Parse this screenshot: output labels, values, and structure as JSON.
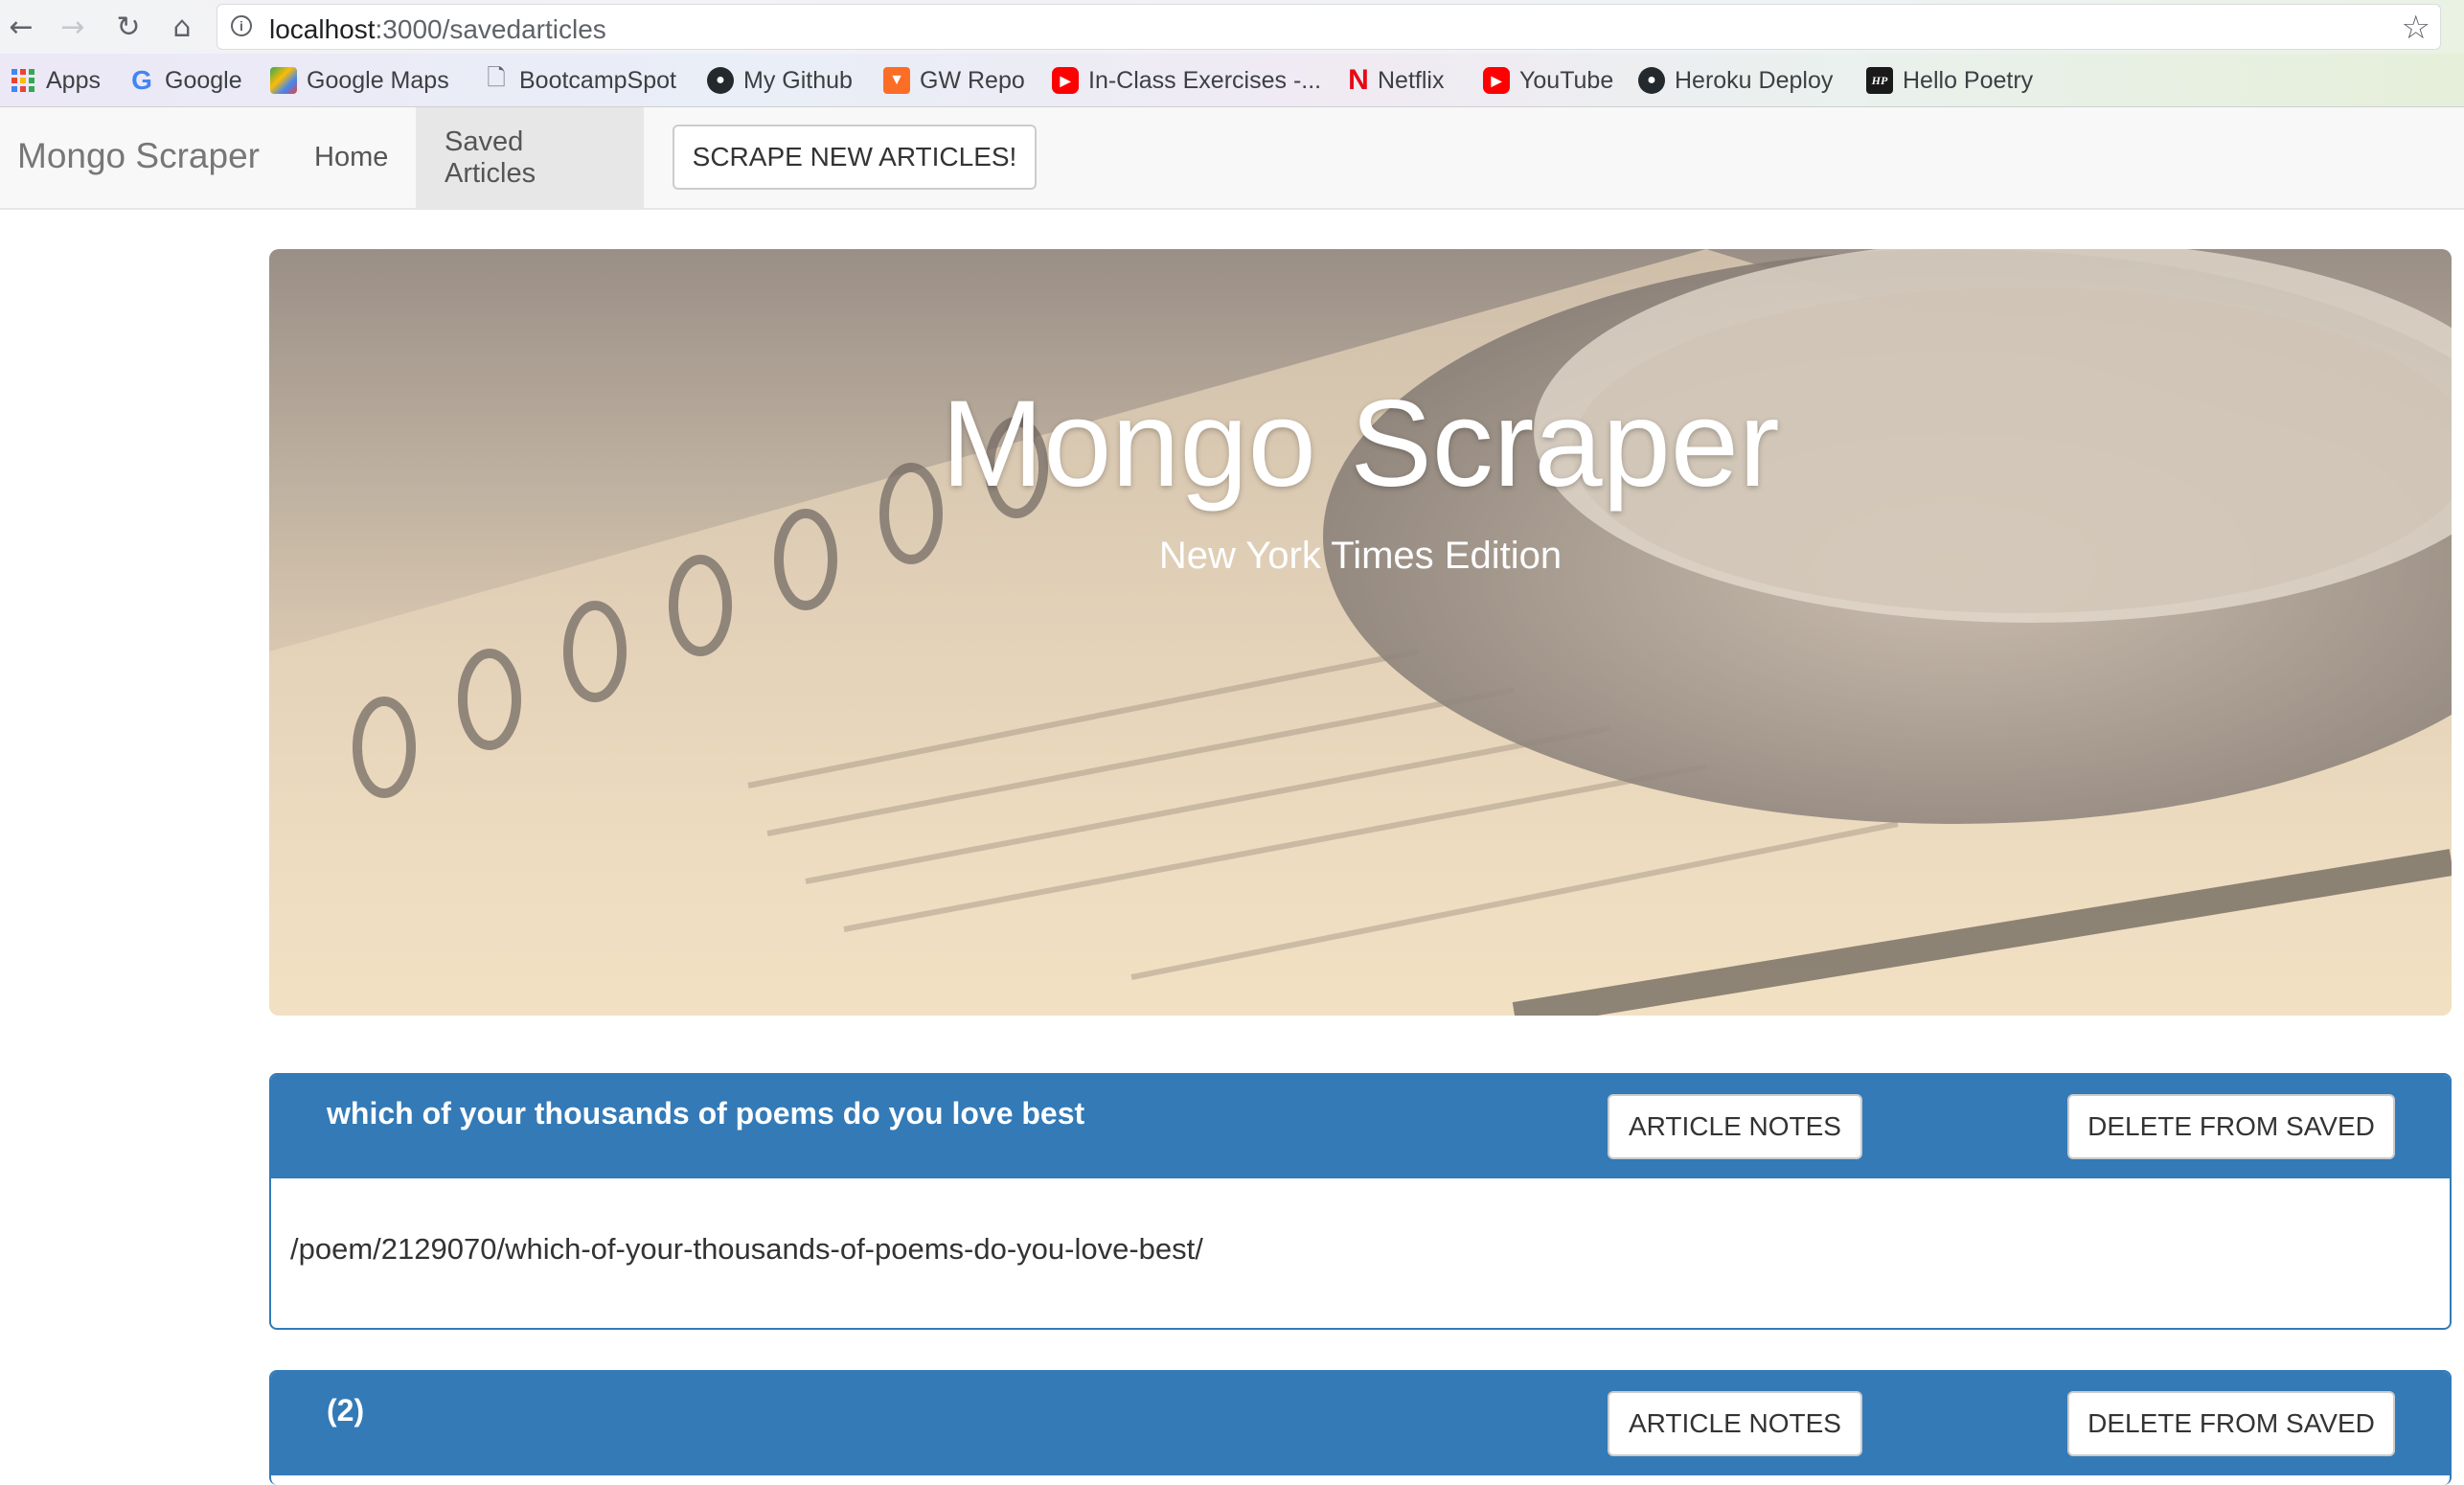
{
  "browser": {
    "url_host": "localhost",
    "url_path": ":3000/savedarticles",
    "bookmarks": [
      {
        "label": "Apps",
        "icon": "apps-grid-icon"
      },
      {
        "label": "Google",
        "icon": "google-icon"
      },
      {
        "label": "Google Maps",
        "icon": "google-maps-icon"
      },
      {
        "label": "BootcampSpot",
        "icon": "page-icon"
      },
      {
        "label": "My Github",
        "icon": "github-icon"
      },
      {
        "label": "GW Repo",
        "icon": "gitlab-icon"
      },
      {
        "label": "In-Class Exercises -...",
        "icon": "youtube-icon"
      },
      {
        "label": "Netflix",
        "icon": "netflix-icon"
      },
      {
        "label": "YouTube",
        "icon": "youtube-icon"
      },
      {
        "label": "Heroku Deploy",
        "icon": "github-icon"
      },
      {
        "label": "Hello Poetry",
        "icon": "hello-poetry-icon"
      }
    ]
  },
  "navbar": {
    "brand": "Mongo Scraper",
    "links": [
      {
        "label": "Home",
        "active": false
      },
      {
        "label": "Saved Articles",
        "active": true
      }
    ],
    "scrape_button": "SCRAPE NEW ARTICLES!"
  },
  "jumbotron": {
    "title": "Mongo Scraper",
    "subtitle": "New York Times Edition"
  },
  "articles": [
    {
      "title": "which of your thousands of poems do you love best",
      "link": "/poem/2129070/which-of-your-thousands-of-poems-do-you-love-best/",
      "notes_button": "ARTICLE NOTES",
      "delete_button": "DELETE FROM SAVED"
    },
    {
      "title": "(2)",
      "link": "",
      "notes_button": "ARTICLE NOTES",
      "delete_button": "DELETE FROM SAVED"
    }
  ],
  "colors": {
    "panel_primary": "#337ab7",
    "navbar_bg": "#f8f8f8"
  }
}
